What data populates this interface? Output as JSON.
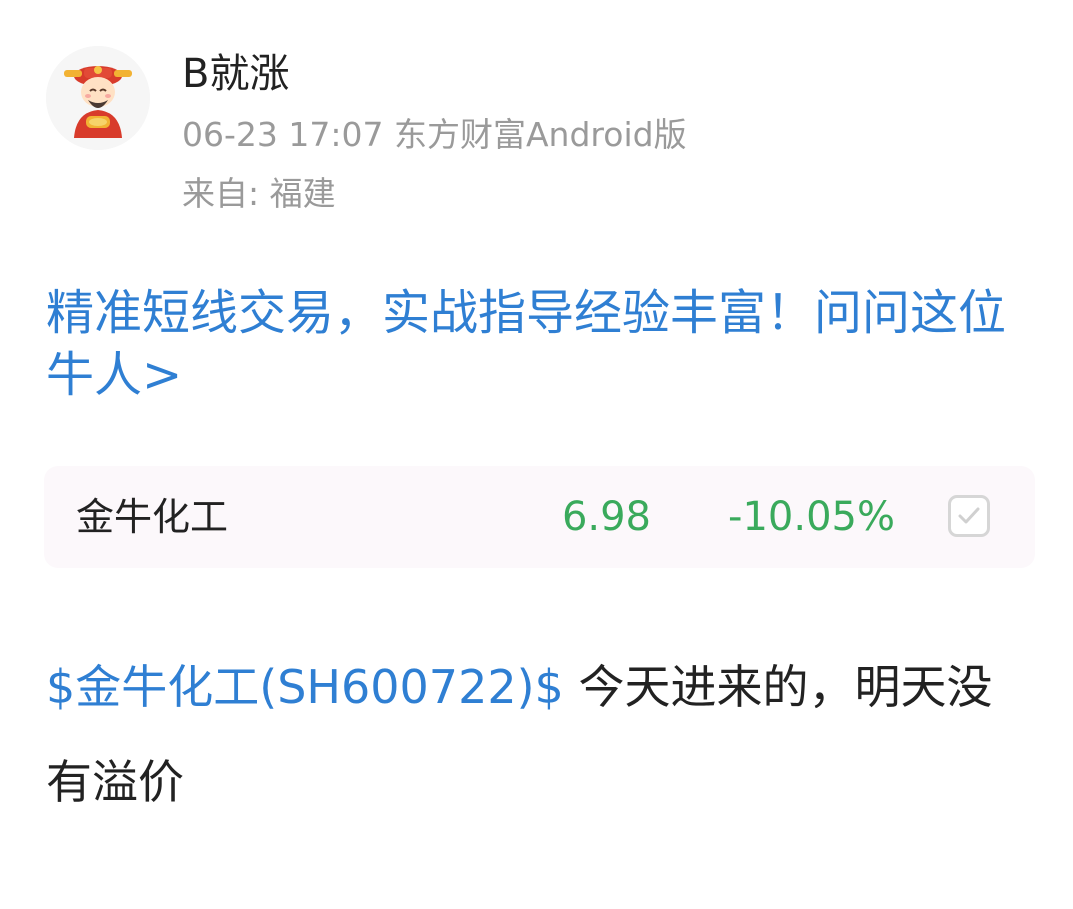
{
  "author": {
    "name": "B就涨",
    "avatar_icon": "god-of-wealth-avatar-icon"
  },
  "post_meta": {
    "timestamp": "06-23 17:07",
    "source": "东方财富Android版",
    "location": "来自: 福建"
  },
  "promo": {
    "text": "精准短线交易，实战指导经验丰富！问问这位牛人>"
  },
  "stock_card": {
    "name": "金牛化工",
    "price": "6.98",
    "change_pct": "-10.05%",
    "checkbox_icon": "checkbox-check-icon"
  },
  "post": {
    "stock_link": "$金牛化工(SH600722)$",
    "text": " 今天进来的，明天没有溢价"
  },
  "colors": {
    "link_blue": "#2f7fd3",
    "down_green": "#3aaa5c",
    "meta_gray": "#9a9a9a"
  }
}
